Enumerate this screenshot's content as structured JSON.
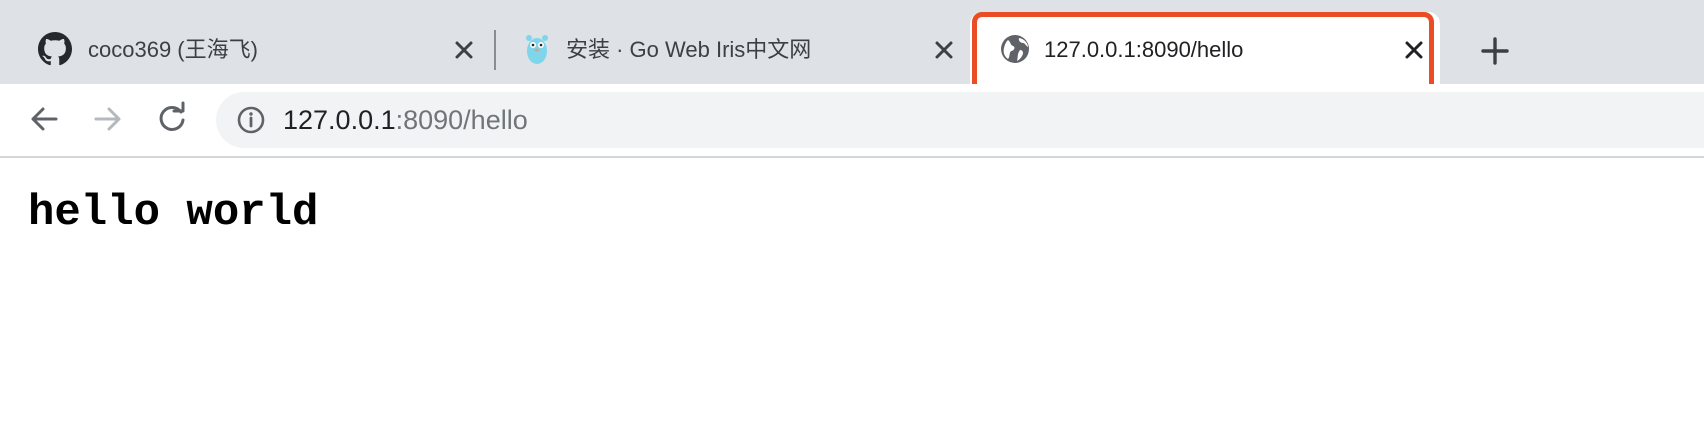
{
  "tabs": [
    {
      "title": "coco369 (王海飞)",
      "favicon": "github-icon"
    },
    {
      "title": "安装 · Go Web Iris中文网",
      "favicon": "gopher-icon"
    },
    {
      "title": "127.0.0.1:8090/hello",
      "favicon": "globe-icon",
      "active": true
    }
  ],
  "toolbar": {
    "url_host": "127.0.0.1",
    "url_rest": ":8090/hello"
  },
  "page": {
    "content": "hello world"
  },
  "colors": {
    "tabstrip": "#dee1e6",
    "highlight": "#ea4d25",
    "omnibox": "#f1f3f4"
  }
}
